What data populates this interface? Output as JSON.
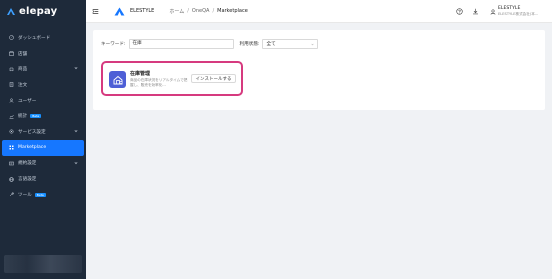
{
  "brand": {
    "name": "elepay"
  },
  "sidebar": {
    "items": [
      {
        "label": "ダッシュボード",
        "icon": "dashboard-icon"
      },
      {
        "label": "店舗",
        "icon": "store-icon"
      },
      {
        "label": "商品",
        "icon": "product-icon",
        "expandable": true
      },
      {
        "label": "注文",
        "icon": "order-icon"
      },
      {
        "label": "ユーザー",
        "icon": "user-icon"
      },
      {
        "label": "統計",
        "icon": "chart-icon",
        "badge": "Beta"
      },
      {
        "label": "サービス設定",
        "icon": "settings-icon",
        "expandable": true
      },
      {
        "label": "Marketplace",
        "icon": "grid-icon",
        "active": true
      },
      {
        "label": "規約設定",
        "icon": "document-icon",
        "expandable": true
      },
      {
        "label": "言語設定",
        "icon": "globe-icon"
      },
      {
        "label": "ツール",
        "icon": "tool-icon",
        "badge": "Beta"
      }
    ]
  },
  "header": {
    "tenant_name": "ELESTYLE",
    "breadcrumb": [
      "ホーム",
      "OneQA",
      "Marketplace"
    ],
    "user_name": "ELESTYLE",
    "user_company": "ELESTYLE株式会社(本..."
  },
  "filters": {
    "keyword_label": "キーワード:",
    "keyword_value": "在庫",
    "status_label": "利用状態:",
    "status_value": "全て"
  },
  "app_card": {
    "title": "在庫管理",
    "description": "商品の在庫状況をリアルタイムで把握し、販売を効率化...",
    "install_label": "インストールする"
  },
  "colors": {
    "sidebar_bg": "#1e2a3a",
    "active_item": "#1677ff",
    "highlight_border": "#d63a7f",
    "app_icon_bg": "#4e5fd6"
  }
}
